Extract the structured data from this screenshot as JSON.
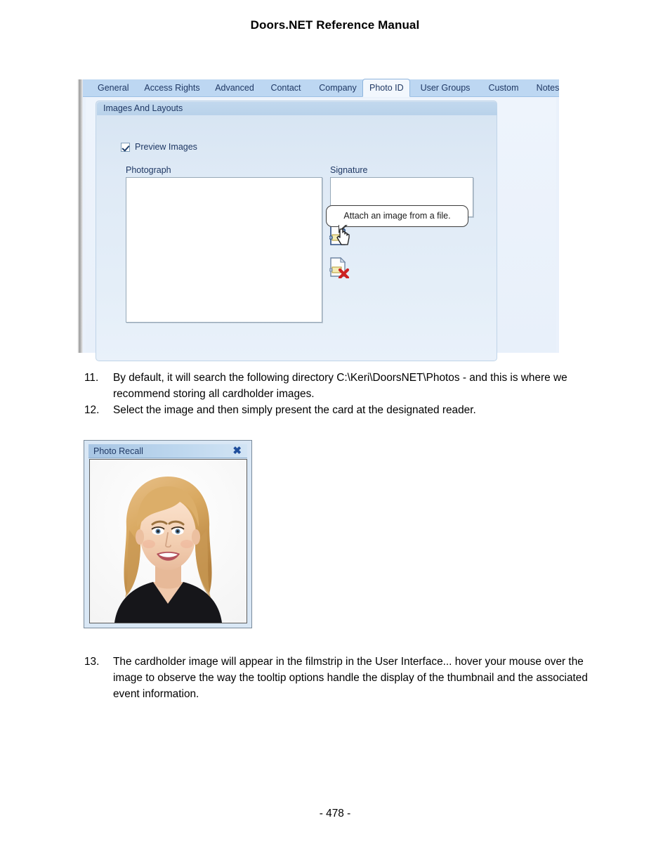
{
  "document": {
    "header_title": "Doors.NET Reference Manual",
    "page_number": "- 478 -"
  },
  "screenshot_photo_id": {
    "tabs": [
      {
        "label": "General",
        "selected": false
      },
      {
        "label": "Access Rights",
        "selected": false
      },
      {
        "label": "Advanced",
        "selected": false
      },
      {
        "label": "Contact",
        "selected": false
      },
      {
        "label": "Company",
        "selected": false
      },
      {
        "label": "Photo ID",
        "selected": true
      },
      {
        "label": "User Groups",
        "selected": false
      },
      {
        "label": "Custom",
        "selected": false
      },
      {
        "label": "Notes",
        "selected": false
      }
    ],
    "panel_caption": "Images And Layouts",
    "preview_images": {
      "label": "Preview Images",
      "checked": true
    },
    "photograph_label": "Photograph",
    "signature_label": "Signature",
    "photograph_value": "",
    "signature_value": "",
    "tooltip_text": "Attach an image from a file.",
    "icons": {
      "attach": "attach-image-icon",
      "delete": "delete-image-icon",
      "cursor": "hand-cursor"
    },
    "colors": {
      "tabstrip": "#bdd7f2",
      "tab_text": "#1f3864",
      "panel_caption": "#c2d8ee",
      "panel_body": "#dfeaf6",
      "outer_body": "#eaf1fb"
    }
  },
  "list_a": [
    {
      "number": "11.",
      "text": "By default, it will search the following directory C:\\Keri\\DoorsNET\\Photos - and this is where we recommend storing all cardholder images."
    },
    {
      "number": "12.",
      "text": "Select the image and then simply present the card at the designated reader."
    }
  ],
  "screenshot_photo_recall": {
    "title": "Photo Recall",
    "close_label": "✖",
    "photo_description": "Headshot portrait of a smiling blonde woman wearing a black top on a white background",
    "colors": {
      "titlebar": "#a8c6e4",
      "title_text": "#1f3864",
      "close_icon": "#1f4e9c",
      "frame": "#d9e7f5"
    }
  },
  "list_b": [
    {
      "number": "13.",
      "text": "The cardholder image will appear in the filmstrip in the User Interface... hover your mouse over the image to observe the way the tooltip options handle the display of the thumbnail and the associated event information."
    }
  ]
}
